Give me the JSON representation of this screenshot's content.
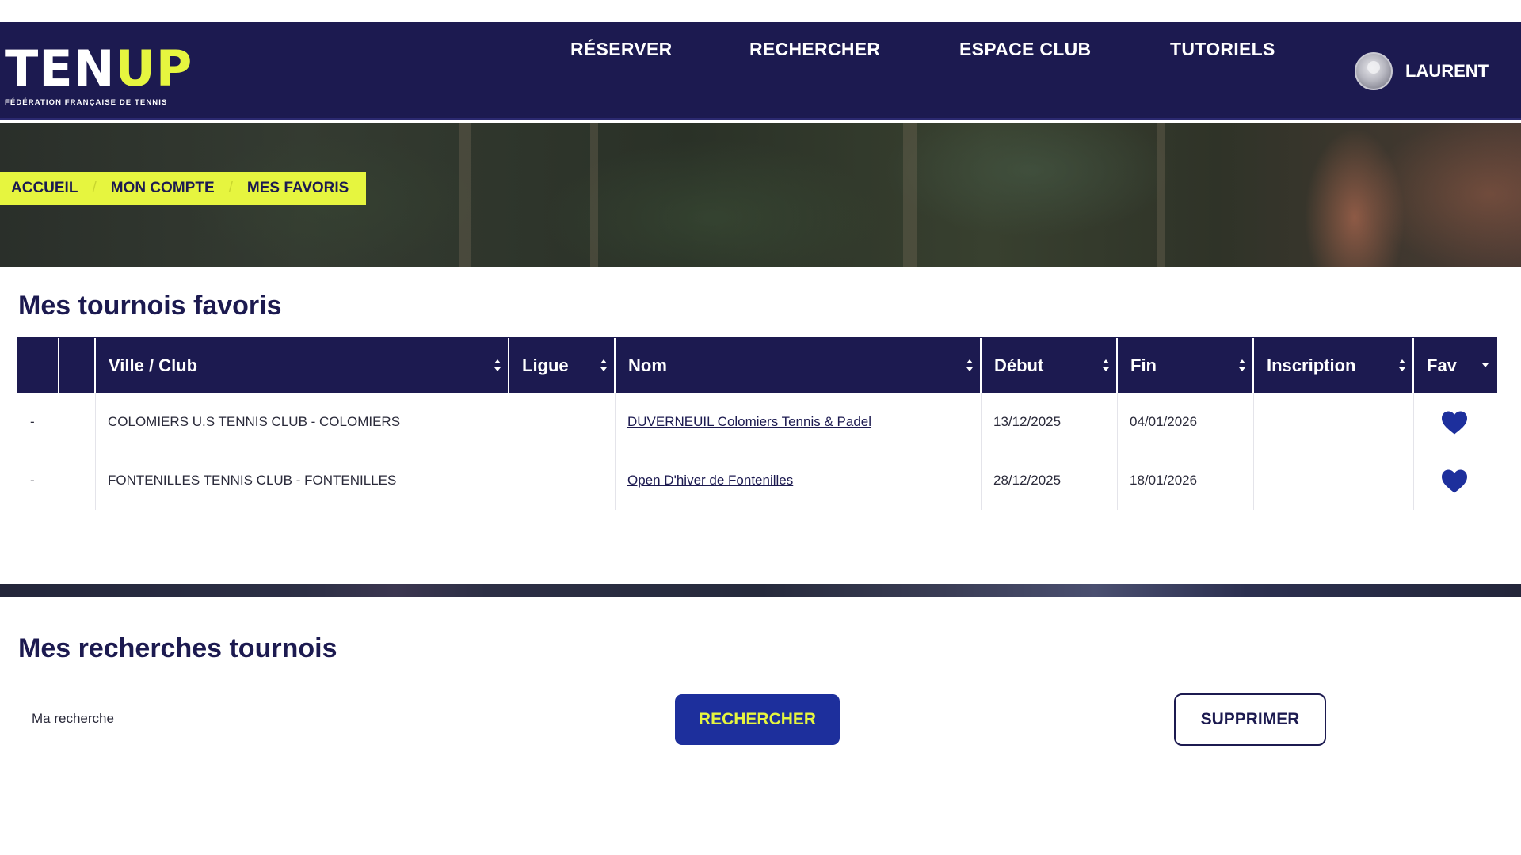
{
  "brand": {
    "logo_ten": "TEN",
    "logo_up": "UP",
    "tagline": "FÉDÉRATION FRANÇAISE DE TENNIS"
  },
  "nav": {
    "items": [
      {
        "label": "RÉSERVER"
      },
      {
        "label": "RECHERCHER"
      },
      {
        "label": "ESPACE CLUB"
      },
      {
        "label": "TUTORIELS"
      }
    ],
    "user_name": "LAURENT"
  },
  "breadcrumb": [
    {
      "label": "ACCUEIL"
    },
    {
      "label": "MON COMPTE"
    },
    {
      "label": "MES FAVORIS"
    }
  ],
  "favorites": {
    "title": "Mes tournois favoris",
    "columns": [
      "",
      "",
      "Ville / Club",
      "Ligue",
      "Nom",
      "Début",
      "Fin",
      "Inscription",
      "Fav"
    ],
    "rows": [
      {
        "col0": "-",
        "col1": "",
        "club": "COLOMIERS U.S TENNIS CLUB - COLOMIERS",
        "ligue": "",
        "nom": "DUVERNEUIL Colomiers Tennis & Padel",
        "debut": "13/12/2025",
        "fin": "04/01/2026",
        "inscription": "",
        "fav": true
      },
      {
        "col0": "-",
        "col1": "",
        "club": "FONTENILLES TENNIS CLUB - FONTENILLES",
        "ligue": "",
        "nom": "Open D'hiver de Fontenilles",
        "debut": "28/12/2025",
        "fin": "18/01/2026",
        "inscription": "",
        "fav": true
      }
    ]
  },
  "searches": {
    "title": "Mes recherches tournois",
    "item_label": "Ma recherche",
    "search_button": "RECHERCHER",
    "delete_button": "SUPPRIMER"
  },
  "colors": {
    "navy": "#1c1a50",
    "accent_yellow": "#e6f53f",
    "button_blue": "#1d2f9c",
    "heart": "#1d2f9c"
  }
}
